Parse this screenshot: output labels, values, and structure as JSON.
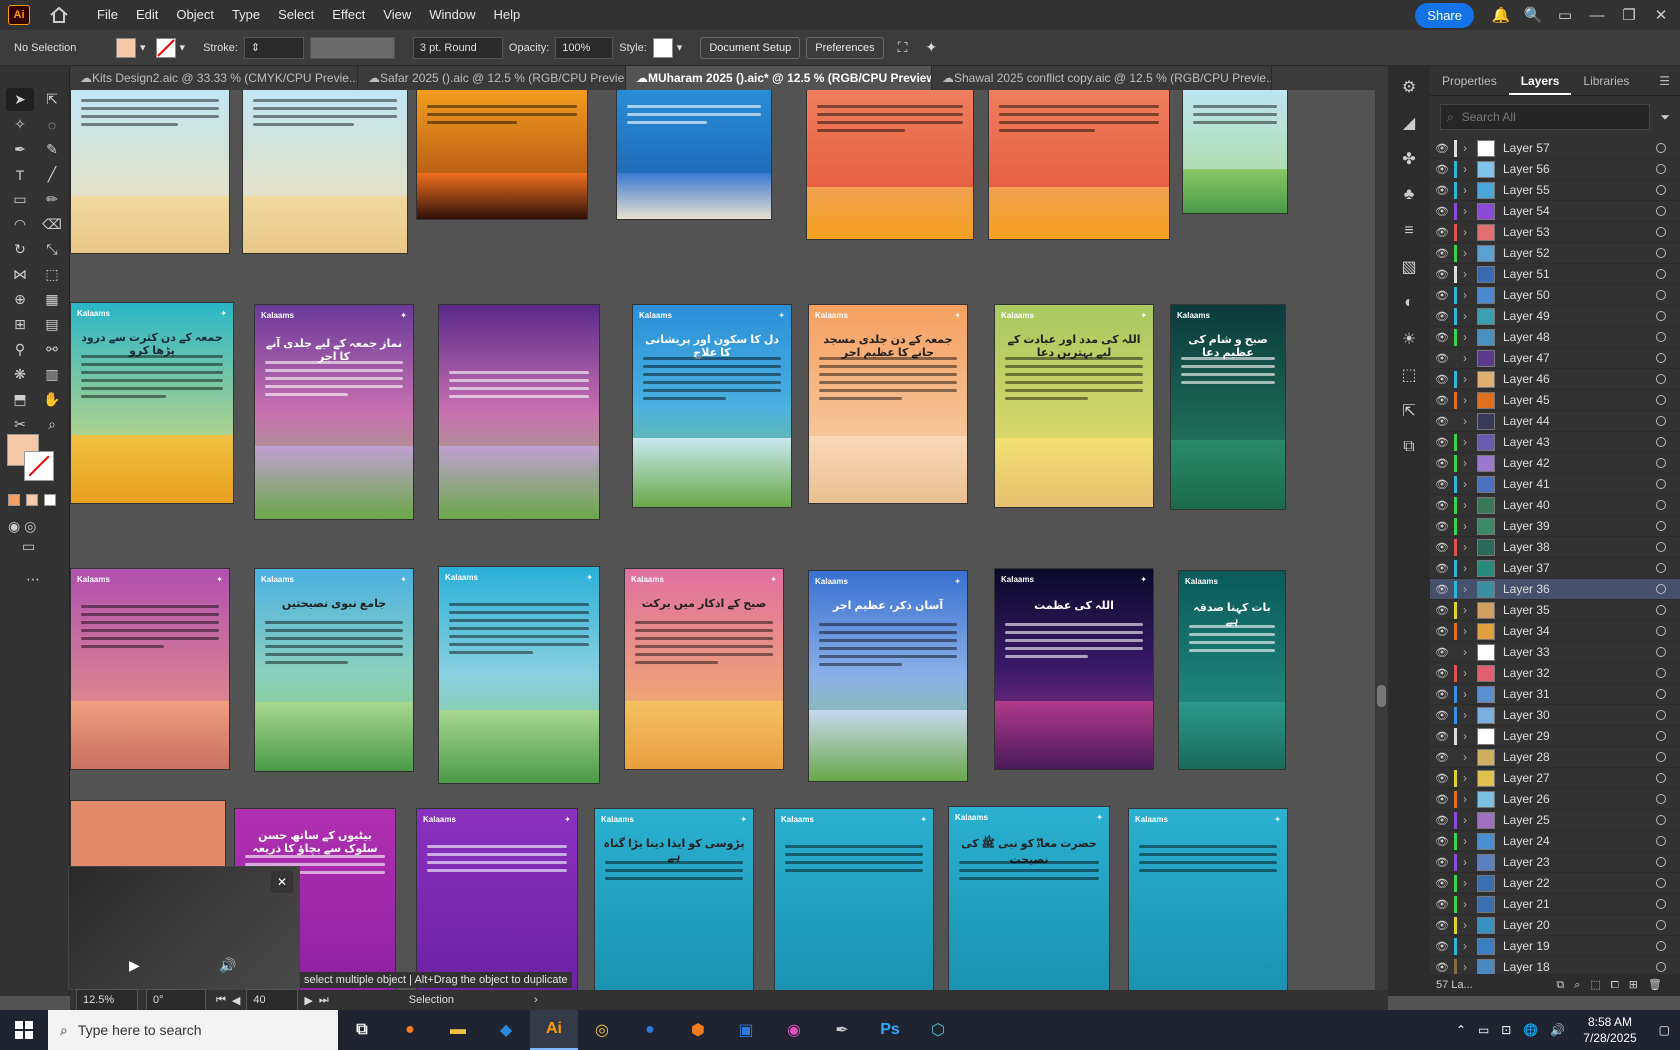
{
  "app": {
    "logo": "Ai"
  },
  "menu": [
    "File",
    "Edit",
    "Object",
    "Type",
    "Select",
    "Effect",
    "View",
    "Window",
    "Help"
  ],
  "menubar_right": {
    "share": "Share"
  },
  "control": {
    "selection": "No Selection",
    "stroke_label": "Stroke:",
    "brush": "3 pt. Round",
    "opacity_label": "Opacity:",
    "opacity": "100%",
    "style_label": "Style:",
    "doc_setup": "Document Setup",
    "preferences": "Preferences"
  },
  "tabs": [
    {
      "label": "Kits Design2.aic @ 33.33 % (CMYK/CPU Previe...",
      "active": false
    },
    {
      "label": "Safar 2025 ().aic @ 12.5 % (RGB/CPU Previe...",
      "active": false
    },
    {
      "label": "MUharam 2025 ().aic* @ 12.5 % (RGB/CPU Preview)",
      "active": true
    },
    {
      "label": "Shawal 2025 conflict copy.aic @ 12.5 % (RGB/CPU Previe...",
      "active": false
    }
  ],
  "panel": {
    "tabs": [
      "Properties",
      "Layers",
      "Libraries"
    ],
    "search_placeholder": "Search All",
    "layers": [
      {
        "name": "Layer 57",
        "color": "#e0e0e0",
        "thumb": "#ffffff"
      },
      {
        "name": "Layer 56",
        "color": "#2cb6d8",
        "thumb": "#7ec4e8"
      },
      {
        "name": "Layer 55",
        "color": "#2cb6d8",
        "thumb": "#4aa6d8"
      },
      {
        "name": "Layer 54",
        "color": "#8a4ad8",
        "thumb": "#8a4ad8"
      },
      {
        "name": "Layer 53",
        "color": "#e05050",
        "thumb": "#e07070"
      },
      {
        "name": "Layer 52",
        "color": "#3ad050",
        "thumb": "#5aa0d0"
      },
      {
        "name": "Layer 51",
        "color": "#e0e0e0",
        "thumb": "#3a6ab0"
      },
      {
        "name": "Layer 50",
        "color": "#2cb6d8",
        "thumb": "#4a8ad0"
      },
      {
        "name": "Layer 49",
        "color": "#2cb6d8",
        "thumb": "#3aa0b0"
      },
      {
        "name": "Layer 48",
        "color": "#3ad050",
        "thumb": "#4a90c0"
      },
      {
        "name": "Layer 47",
        "color": "#333333",
        "thumb": "#5a3a8a"
      },
      {
        "name": "Layer 46",
        "color": "#2cb6d8",
        "thumb": "#e0b070"
      },
      {
        "name": "Layer 45",
        "color": "#e07020",
        "thumb": "#e07020"
      },
      {
        "name": "Layer 44",
        "color": "#333333",
        "thumb": "#3a3a5a"
      },
      {
        "name": "Layer 43",
        "color": "#3ad050",
        "thumb": "#6a5ab0"
      },
      {
        "name": "Layer 42",
        "color": "#3ad050",
        "thumb": "#9a7ad0"
      },
      {
        "name": "Layer 41",
        "color": "#2cb6d8",
        "thumb": "#4a70c0"
      },
      {
        "name": "Layer 40",
        "color": "#3ad050",
        "thumb": "#3a7a5a"
      },
      {
        "name": "Layer 39",
        "color": "#3ad050",
        "thumb": "#3a8a6a"
      },
      {
        "name": "Layer 38",
        "color": "#e05050",
        "thumb": "#2a6a5a"
      },
      {
        "name": "Layer 37",
        "color": "#2cb6d8",
        "thumb": "#2a8a7a"
      },
      {
        "name": "Layer 36",
        "color": "#2cb6d8",
        "thumb": "#3a90a0"
      },
      {
        "name": "Layer 35",
        "color": "#e0d030",
        "thumb": "#d0a060"
      },
      {
        "name": "Layer 34",
        "color": "#e07020",
        "thumb": "#e0a040"
      },
      {
        "name": "Layer 33",
        "color": "#333333",
        "thumb": "#ffffff"
      },
      {
        "name": "Layer 32",
        "color": "#e05050",
        "thumb": "#e06070"
      },
      {
        "name": "Layer 31",
        "color": "#3a90e0",
        "thumb": "#5a90d0"
      },
      {
        "name": "Layer 30",
        "color": "#3a90e0",
        "thumb": "#7ab0e0"
      },
      {
        "name": "Layer 29",
        "color": "#e0e0e0",
        "thumb": "#ffffff"
      },
      {
        "name": "Layer 28",
        "color": "#333333",
        "thumb": "#d0b060"
      },
      {
        "name": "Layer 27",
        "color": "#e0d030",
        "thumb": "#e0c050"
      },
      {
        "name": "Layer 26",
        "color": "#e07020",
        "thumb": "#7ac0e0"
      },
      {
        "name": "Layer 25",
        "color": "#8a4ad8",
        "thumb": "#a070c0"
      },
      {
        "name": "Layer 24",
        "color": "#3ad050",
        "thumb": "#4a90d0"
      },
      {
        "name": "Layer 23",
        "color": "#8a4ad8",
        "thumb": "#5a80c0"
      },
      {
        "name": "Layer 22",
        "color": "#3ad050",
        "thumb": "#3a70b0"
      },
      {
        "name": "Layer 21",
        "color": "#3ad050",
        "thumb": "#3a70b0"
      },
      {
        "name": "Layer 20",
        "color": "#e0d030",
        "thumb": "#3a90c0"
      },
      {
        "name": "Layer 19",
        "color": "#2cb6d8",
        "thumb": "#3a80c0"
      },
      {
        "name": "Layer 18",
        "color": "#8a6a40",
        "thumb": "#4a8ac0"
      }
    ],
    "selected": "Layer 36",
    "footer": "57 La..."
  },
  "status": {
    "zoom": "12.5%",
    "rotate": "0°",
    "artboard": "40",
    "tool": "Selection",
    "hint": "select multiple object  |  Alt+Drag the object to duplicate"
  },
  "taskbar": {
    "search": "Type here to search",
    "time": "8:58 AM",
    "date": "7/28/2025",
    "apps": [
      "Ps"
    ]
  },
  "artboard_text": {
    "title_r2_1": "جمعہ کے دن کثرت سے درود پڑھا کرو",
    "title_r2_2": "نماز جمعہ کے لیے جلدی آنے کا اجر",
    "title_r2_4": "دل کا سکون اور پریشانی کا علاج",
    "title_r2_5": "جمعہ کے دن جلدی مسجد جانے کا عظیم اجر",
    "title_r2_6": "اللہ کی مدد اور عبادت کے لیے بہترین دعا",
    "title_r2_7": "صبح و شام کی عظیم دعا",
    "title_r3_2": "جامع نبوی نصیحتیں",
    "title_r3_4": "صبح کے اذکار میں برکت",
    "title_r3_5": "آسان ذکر، عظیم اجر",
    "title_r3_6": "اللہ کی عظمت",
    "title_r3_7": "بات کہنا صدقہ ہے",
    "title_r4_3": "پڑوسی کو ایذا دینا بڑا گناہ ہے",
    "title_r4_4": "حضرت معاذؓ کو نبی ﷺ کی نصیحت",
    "title_r4_1": "بیٹیوں کے ساتھ حسن سلوک سے بچاؤ کا ذریعہ",
    "brand": "Kalaams"
  }
}
